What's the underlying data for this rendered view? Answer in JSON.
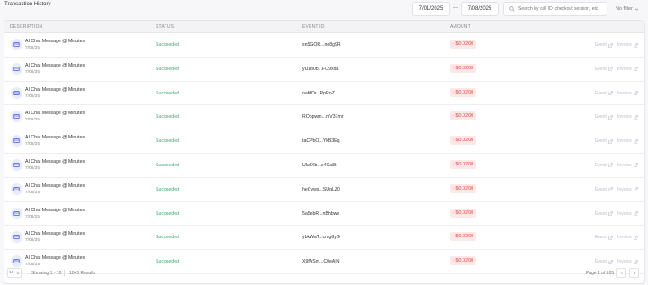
{
  "header": {
    "title": "Transaction History",
    "date_from": "7/01/2025",
    "date_separator": "—",
    "date_to": "7/08/2025",
    "search_placeholder": "Search by call ID, checkout session, etc.",
    "filter_label": "No filter"
  },
  "table": {
    "columns": {
      "description": "DESCRIPTION",
      "status": "STATUS",
      "event_id": "EVENT ID",
      "amount": "AMOUNT"
    },
    "event_link_label": "Event",
    "invoice_link_label": "Invoice",
    "rows": [
      {
        "description": "AI Chat Message @  Minutes",
        "date": "7/08/25",
        "status": "Succeeded",
        "event_id": "sn5GOR...no8g9R",
        "amount": "- $0.0200"
      },
      {
        "description": "AI Chat Message @  Minutes",
        "date": "7/08/25",
        "status": "Succeeded",
        "event_id": "yUzd0b...FO9xda",
        "amount": "- $0.0200"
      },
      {
        "description": "AI Chat Message @  Minutes",
        "date": "7/08/25",
        "status": "Succeeded",
        "event_id": "oafdDr...PpRoZ",
        "amount": "- $0.0200"
      },
      {
        "description": "AI Chat Message @  Minutes",
        "date": "7/08/25",
        "status": "Succeeded",
        "event_id": "ROopwm...mV37mr",
        "amount": "- $0.0200"
      },
      {
        "description": "AI Chat Message @  Minutes",
        "date": "7/08/25",
        "status": "Succeeded",
        "event_id": "taCPbO...YkB3Eq",
        "amount": "- $0.0200"
      },
      {
        "description": "AI Chat Message @  Minutes",
        "date": "7/08/25",
        "status": "Succeeded",
        "event_id": "UkslXb...e4Ca8t",
        "amount": "- $0.0200"
      },
      {
        "description": "AI Chat Message @  Minutes",
        "date": "7/08/25",
        "status": "Succeeded",
        "event_id": "heCvws...SUqLZ0",
        "amount": "- $0.0200"
      },
      {
        "description": "AI Chat Message @  Minutes",
        "date": "7/08/25",
        "status": "Succeeded",
        "event_id": "5a5ebR...nBhbwe",
        "amount": "- $0.0200"
      },
      {
        "description": "AI Chat Message @  Minutes",
        "date": "7/08/25",
        "status": "Succeeded",
        "event_id": "ybkWaT...cmg8yG",
        "amount": "- $0.0200"
      },
      {
        "description": "AI Chat Message @  Minutes",
        "date": "7/08/25",
        "status": "Succeeded",
        "event_id": "X9fASm...C0eAIN",
        "amount": "- $0.0200"
      }
    ]
  },
  "footer": {
    "page_size": "10",
    "showing": "Showing 1 - 10",
    "results": "1043 Results",
    "page_info": "Page 1 of 105"
  },
  "colors": {
    "success": "#3aa76d",
    "amount_text": "#e24a4a",
    "amount_bg": "#fde8e8",
    "icon_bg": "#e8ecfb",
    "icon_fg": "#5b6ee1"
  },
  "icons": {
    "row": "message-card-icon",
    "link": "external-link-icon",
    "search": "search-icon",
    "filter": "chevron-down-icon"
  }
}
